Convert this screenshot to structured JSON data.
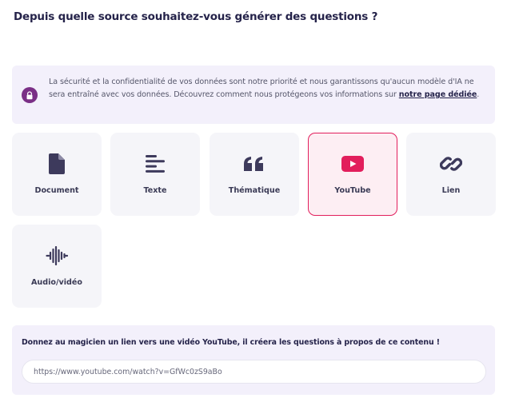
{
  "header": {
    "title": "Depuis quelle source souhaitez-vous générer des questions ?"
  },
  "privacy": {
    "text": "La sécurité et la confidentialité de vos données sont notre priorité et nous garantissons qu'aucun modèle d'IA ne sera entraîné avec vos données. Découvrez comment nous protégeons vos informations sur ",
    "link_label": "notre page dédiée",
    "trailing": ".",
    "icon": "lock-icon",
    "icon_bg": "#7a2f86"
  },
  "sources": [
    {
      "label": "Document",
      "icon": "document-icon",
      "selected": false
    },
    {
      "label": "Texte",
      "icon": "text-lines-icon",
      "selected": false
    },
    {
      "label": "Thématique",
      "icon": "quote-icon",
      "selected": false
    },
    {
      "label": "YouTube",
      "icon": "youtube-icon",
      "selected": true
    },
    {
      "label": "Lien",
      "icon": "link-icon",
      "selected": false
    },
    {
      "label": "Audio/vidéo",
      "icon": "audio-wave-icon",
      "selected": false
    }
  ],
  "youtube": {
    "prompt": "Donnez au magicien un lien vers une vidéo YouTube, il créera les questions à propos de ce contenu !",
    "url_value": "https://www.youtube.com/watch?v=GfWc0zS9aBo"
  },
  "colors": {
    "accent": "#e21e5c",
    "selected_bg": "#fdeef3",
    "card_bg": "#f5f5f9",
    "panel_bg": "#f3f0fb",
    "icon": "#3d3a5c"
  }
}
